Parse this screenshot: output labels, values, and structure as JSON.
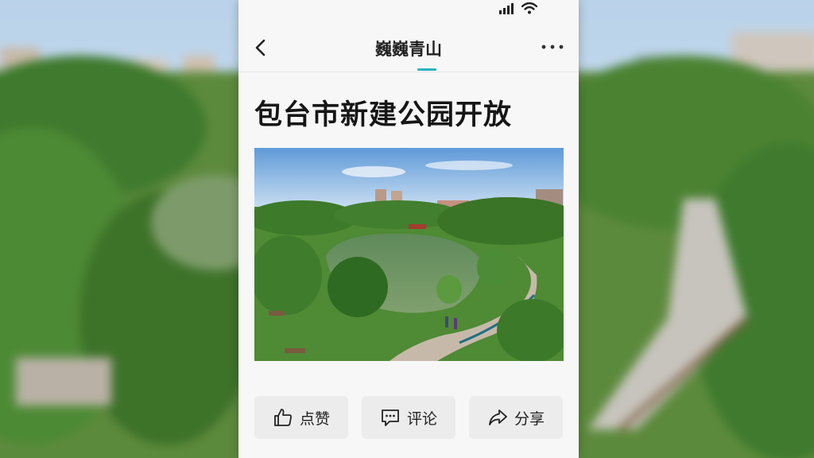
{
  "header": {
    "title": "巍巍青山"
  },
  "article": {
    "headline": "包台市新建公园开放"
  },
  "actions": {
    "like_label": "点赞",
    "comment_label": "评论",
    "share_label": "分享"
  },
  "icons": [
    "signal-icon",
    "wifi-icon",
    "back-icon",
    "more-icon",
    "thumbs-up-icon",
    "comment-icon",
    "share-icon"
  ],
  "colors": {
    "accent": "#2bb3c0",
    "page_background": "#f7f7f7",
    "button_background": "#ececec"
  }
}
